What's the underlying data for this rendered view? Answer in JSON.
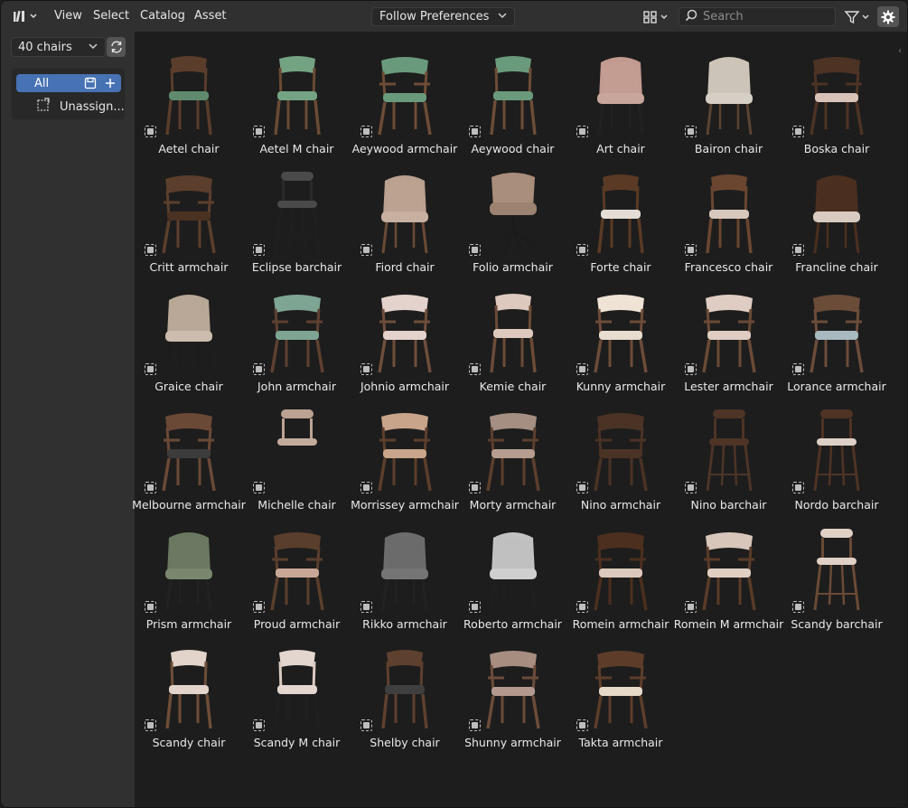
{
  "header": {
    "menus": [
      "View",
      "Select",
      "Catalog",
      "Asset"
    ],
    "import_method": "Follow Preferences",
    "search_placeholder": "Search"
  },
  "sidebar": {
    "library": "40 chairs",
    "catalogs": {
      "all_label": "All",
      "unassigned_label": "Unassign..."
    }
  },
  "assets": [
    {
      "name": "Aetel chair",
      "type": "chair",
      "frame": "#5a3d2b",
      "seat": "#5f8a6e",
      "back": "#5a3d2b",
      "legs": "#5a3d2b"
    },
    {
      "name": "Aetel M chair",
      "type": "chair",
      "frame": "#6a4a34",
      "seat": "#74a384",
      "back": "#74a384",
      "legs": "#6a4a34"
    },
    {
      "name": "Aeywood armchair",
      "type": "armchair",
      "frame": "#6d4c36",
      "seat": "#6a9a7c",
      "back": "#6a9a7c",
      "legs": "#6d4c36"
    },
    {
      "name": "Aeywood chair",
      "type": "chair",
      "frame": "#6d4c36",
      "seat": "#6a9a7c",
      "back": "#6a9a7c",
      "legs": "#6d4c36"
    },
    {
      "name": "Art chair",
      "type": "shell",
      "frame": "#c7a097",
      "seat": "#c9a69b",
      "back": "#c29a90",
      "legs": "#222222"
    },
    {
      "name": "Bairon chair",
      "type": "shell",
      "frame": "#cfc6bb",
      "seat": "#d6cfc5",
      "back": "#cdc4b8",
      "legs": "#5b4331"
    },
    {
      "name": "Boska chair",
      "type": "armchair",
      "frame": "#4d3324",
      "seat": "#d9c2b8",
      "back": "#4d3324",
      "legs": "#4d3324"
    },
    {
      "name": "Critt armchair",
      "type": "armchair",
      "frame": "#5b3f2c",
      "seat": "#4a3222",
      "back": "#5b3f2c",
      "legs": "#5b3f2c"
    },
    {
      "name": "Eclipse barchair",
      "type": "barchair",
      "frame": "#2a2a2a",
      "seat": "#4a4a4a",
      "back": "#4a4a4a",
      "legs": "#1f1f1f"
    },
    {
      "name": "Fiord chair",
      "type": "shell",
      "frame": "#bfa796",
      "seat": "#c8b0a0",
      "back": "#b9a08f",
      "legs": "#6a4a34"
    },
    {
      "name": "Folio armchair",
      "type": "swivel",
      "frame": "#a08572",
      "seat": "#9c8270",
      "back": "#a98e7b",
      "legs": "#1b1b1b"
    },
    {
      "name": "Forte chair",
      "type": "chair",
      "frame": "#5a3a24",
      "seat": "#e3ddd6",
      "back": "#5a3a24",
      "legs": "#5a3a24"
    },
    {
      "name": "Francesco chair",
      "type": "chair",
      "frame": "#6a4630",
      "seat": "#d8c7bd",
      "back": "#6a4630",
      "legs": "#6a4630"
    },
    {
      "name": "Francline chair",
      "type": "shell",
      "frame": "#4b2f1f",
      "seat": "#d8cbc0",
      "back": "#4b2f1f",
      "legs": "#4b2f1f"
    },
    {
      "name": "Graice chair",
      "type": "shell",
      "frame": "#b9aa9c",
      "seat": "#cbbcad",
      "back": "#b8a896",
      "legs": "#1c1c1c"
    },
    {
      "name": "John armchair",
      "type": "armchair",
      "frame": "#5e4030",
      "seat": "#7ea494",
      "back": "#7ea494",
      "legs": "#5e4030"
    },
    {
      "name": "Johnio armchair",
      "type": "armchair",
      "frame": "#6e4e3a",
      "seat": "#e3d3cc",
      "back": "#e3d3cc",
      "legs": "#6e4e3a"
    },
    {
      "name": "Kemie chair",
      "type": "chair",
      "frame": "#6b4b37",
      "seat": "#ddc9bd",
      "back": "#ddc9bd",
      "legs": "#6b4b37"
    },
    {
      "name": "Kunny armchair",
      "type": "armchair",
      "frame": "#6d4c38",
      "seat": "#e8dccf",
      "back": "#efe3d6",
      "legs": "#6d4c38"
    },
    {
      "name": "Lester armchair",
      "type": "armchair",
      "frame": "#6a4a36",
      "seat": "#dfccc2",
      "back": "#dfccc2",
      "legs": "#6a4a36"
    },
    {
      "name": "Lorance armchair",
      "type": "armchair",
      "frame": "#6b4c39",
      "seat": "#a9b9c0",
      "back": "#6b4c39",
      "legs": "#6b4c39"
    },
    {
      "name": "Melbourne armchair",
      "type": "armchair",
      "frame": "#6a4936",
      "seat": "#3c3c3c",
      "back": "#6a4936",
      "legs": "#6a4936"
    },
    {
      "name": "Michelle chair",
      "type": "barchair",
      "frame": "#bda394",
      "seat": "#c3ab9b",
      "back": "#bca292",
      "legs": "#1d1d1d"
    },
    {
      "name": "Morrissey armchair",
      "type": "armchair",
      "frame": "#5d3e2b",
      "seat": "#c8a58a",
      "back": "#c8a58a",
      "legs": "#5d3e2b"
    },
    {
      "name": "Morty armchair",
      "type": "armchair",
      "frame": "#5c3f2d",
      "seat": "#b69d8f",
      "back": "#a58f82",
      "legs": "#5c3f2d"
    },
    {
      "name": "Nino armchair",
      "type": "armchair",
      "frame": "#4a3224",
      "seat": "#4a3224",
      "back": "#4a3224",
      "legs": "#4a3224"
    },
    {
      "name": "Nino barchair",
      "type": "barchair",
      "frame": "#4d3426",
      "seat": "#4d3426",
      "back": "#4d3426",
      "legs": "#4d3426"
    },
    {
      "name": "Nordo barchair",
      "type": "barchair",
      "frame": "#4f3324",
      "seat": "#ddd0c6",
      "back": "#4f3324",
      "legs": "#4f3324"
    },
    {
      "name": "Prism armchair",
      "type": "shell",
      "frame": "#6d7a63",
      "seat": "#7a876f",
      "back": "#6b7861",
      "legs": "#222222"
    },
    {
      "name": "Proud armchair",
      "type": "armchair",
      "frame": "#5a3e2c",
      "seat": "#c9a797",
      "back": "#5a3e2c",
      "legs": "#5a3e2c"
    },
    {
      "name": "Rikko armchair",
      "type": "shell",
      "frame": "#6a6a6a",
      "seat": "#757575",
      "back": "#6c6c6c",
      "legs": "#222222"
    },
    {
      "name": "Roberto armchair",
      "type": "shell",
      "frame": "#bdbdbd",
      "seat": "#cfcfcf",
      "back": "#c2c2c2",
      "legs": "#1f1f1f"
    },
    {
      "name": "Romein armchair",
      "type": "armchair",
      "frame": "#4c2f1e",
      "seat": "#dcc9bd",
      "back": "#4c2f1e",
      "legs": "#4c2f1e"
    },
    {
      "name": "Romein M armchair",
      "type": "armchair",
      "frame": "#5a3b28",
      "seat": "#e0cfc3",
      "back": "#d8c6ba",
      "legs": "#5a3b28"
    },
    {
      "name": "Scandy barchair",
      "type": "barchair",
      "frame": "#6a4a35",
      "seat": "#e1d0c6",
      "back": "#e1d0c6",
      "legs": "#6a4a35"
    },
    {
      "name": "Scandy chair",
      "type": "chair",
      "frame": "#6e4d38",
      "seat": "#e2d4ca",
      "back": "#e2d4ca",
      "legs": "#6e4d38"
    },
    {
      "name": "Scandy M chair",
      "type": "chair",
      "frame": "#d9c9bf",
      "seat": "#e2d6ce",
      "back": "#e2d6ce",
      "legs": "#1f1f1f"
    },
    {
      "name": "Shelby chair",
      "type": "chair",
      "frame": "#5e402e",
      "seat": "#3f3f3f",
      "back": "#5e402e",
      "legs": "#5e402e"
    },
    {
      "name": "Shunny armchair",
      "type": "armchair",
      "frame": "#6b4c39",
      "seat": "#b39a8e",
      "back": "#a68d80",
      "legs": "#6b4c39"
    },
    {
      "name": "Takta armchair",
      "type": "armchair",
      "frame": "#5d3d2a",
      "seat": "#e7d9c8",
      "back": "#5d3d2a",
      "legs": "#5d3d2a"
    }
  ],
  "colors": {
    "accent": "#4772b3",
    "header": "#303030",
    "panel": "#1d1d1d"
  }
}
